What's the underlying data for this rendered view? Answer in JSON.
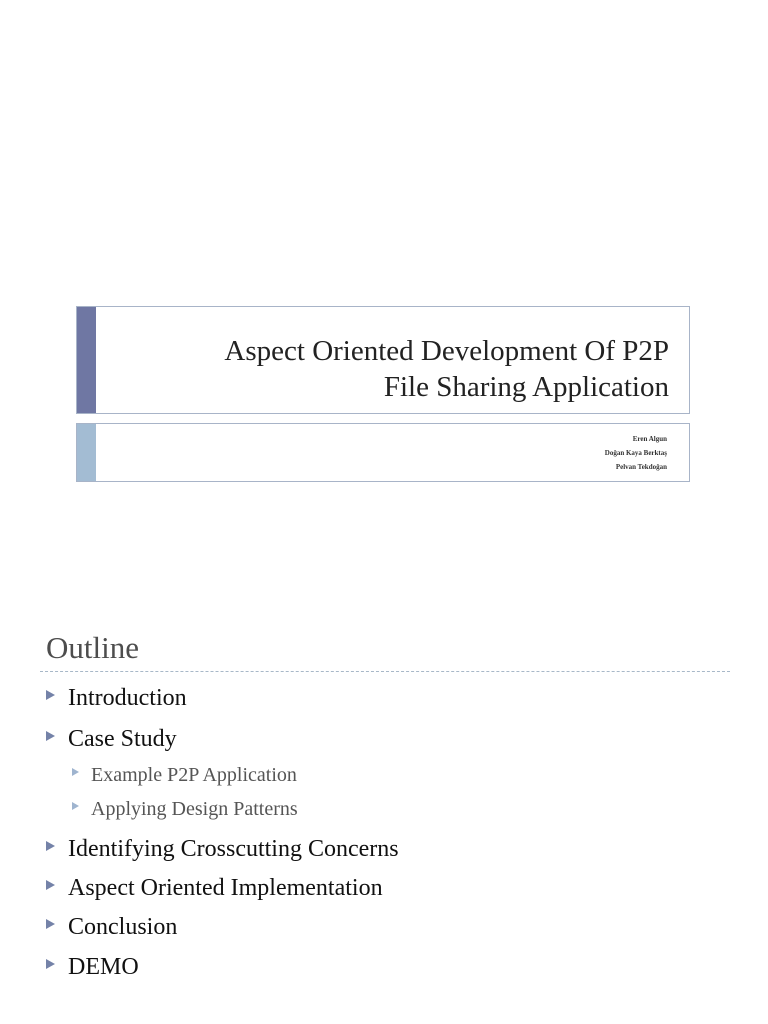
{
  "slide1": {
    "title_line1": "Aspect Oriented Development Of P2P",
    "title_line2": "File Sharing Application",
    "authors": [
      "Eren Algun",
      "Doğan Kaya Berktaş",
      "Pelvan Tekdoğan"
    ]
  },
  "slide2": {
    "title": "Outline",
    "items": [
      "Introduction",
      "Case Study",
      "Example P2P Application",
      "Applying Design Patterns",
      "Identifying Crosscutting Concerns",
      "Aspect Oriented Implementation",
      "Conclusion",
      "DEMO"
    ]
  }
}
